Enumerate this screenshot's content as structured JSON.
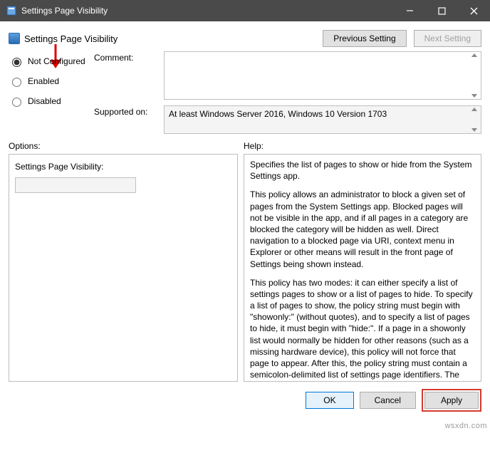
{
  "window": {
    "title": "Settings Page Visibility"
  },
  "header": {
    "title": "Settings Page Visibility",
    "prev": "Previous Setting",
    "next": "Next Setting"
  },
  "config": {
    "not_configured": "Not Configured",
    "enabled": "Enabled",
    "disabled": "Disabled",
    "comment_label": "Comment:",
    "supported_label": "Supported on:",
    "supported_value": "At least Windows Server 2016, Windows 10 Version 1703"
  },
  "labels": {
    "options": "Options:",
    "help": "Help:"
  },
  "options": {
    "field_label": "Settings Page Visibility:",
    "value": ""
  },
  "help": {
    "p1": "Specifies the list of pages to show or hide from the System Settings app.",
    "p2": "This policy allows an administrator to block a given set of pages from the System Settings app. Blocked pages will not be visible in the app, and if all pages in a category are blocked the category will be hidden as well. Direct navigation to a blocked page via URI, context menu in Explorer or other means will result in the front page of Settings being shown instead.",
    "p3": "This policy has two modes: it can either specify a list of settings pages to show or a list of pages to hide. To specify a list of pages to show, the policy string must begin with \"showonly:\" (without quotes), and to specify a list of pages to hide, it must begin with \"hide:\". If a page in a showonly list would normally be hidden for other reasons (such as a missing hardware device), this policy will not force that page to appear. After this, the policy string must contain a semicolon-delimited list of settings page identifiers. The identifier for any given settings page is the published URI for that page, minus the \"ms-settings:\" protocol part."
  },
  "footer": {
    "ok": "OK",
    "cancel": "Cancel",
    "apply": "Apply"
  },
  "watermark": "wsxdn.com"
}
